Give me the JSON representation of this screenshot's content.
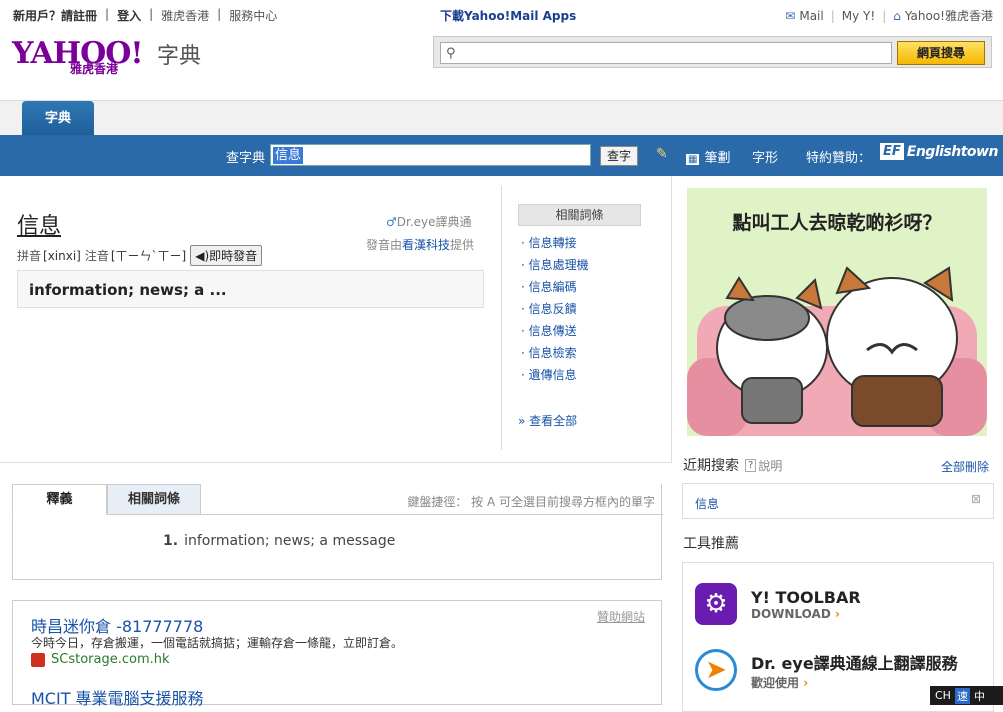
{
  "topbar": {
    "new_user": "新用戶？請註冊",
    "login": "登入",
    "yahoo_hk": "雅虎香港",
    "service": "服務中心",
    "download": "下載Yahoo!Mail Apps",
    "mail": "Mail",
    "my_y": "My Y!",
    "home": "Yahoo!雅虎香港"
  },
  "logo": {
    "brand": "YAHOO!",
    "region": "雅虎香港",
    "product": "字典"
  },
  "websearch": {
    "value": "",
    "button": "網頁搜尋"
  },
  "nav": {
    "tab": "字典"
  },
  "lookup": {
    "label": "查字典",
    "query": "信息",
    "button": "查字",
    "strokes": "筆劃",
    "shape": "字形",
    "sponsor": "特約贊助：",
    "sponsor_ef": "EF",
    "sponsor_name": "Englishtown"
  },
  "entry": {
    "word": "信息",
    "pinyin_label": "拼音",
    "pinyin": "[xinxi]",
    "zhuyin_label": "注音",
    "zhuyin": "[ㄒㄧㄣˋㄒㄧ]",
    "sound_button": "即時發音",
    "provider": "Dr.eye譯典通",
    "voice_prefix": "發音由",
    "voice_company": "看漢科技",
    "voice_suffix": "提供",
    "summary": "information; news; a ..."
  },
  "related": {
    "header": "相關詞條",
    "items": [
      "信息轉接",
      "信息處理機",
      "信息編碼",
      "信息反饋",
      "信息傳送",
      "信息檢索",
      "遺傳信息"
    ],
    "see_all": "» 查看全部"
  },
  "tabs": {
    "definition": "釋義",
    "related": "相關詞條",
    "shortcut_hint": "鍵盤捷徑： 按 A 可全選目前搜尋方框內的單字"
  },
  "definition": {
    "index": "1.",
    "text": "information; news; a message"
  },
  "ads": {
    "sponsored": "贊助網站",
    "ad1_title": "時昌迷你倉 -81777778",
    "ad1_desc": "今時今日，存倉搬運，一個電話就搞掂；運輸存倉一條龍，立即訂倉。",
    "ad1_url": "SCstorage.com.hk",
    "ad2_title": "MCIT 專業電腦支援服務"
  },
  "banner": {
    "text": "點叫工人去晾乾啲衫呀？"
  },
  "recent": {
    "title": "近期搜索",
    "help": "?",
    "help_label": "說明",
    "clear": "全部刪除",
    "items": [
      "信息"
    ]
  },
  "tools": {
    "title": "工具推薦",
    "toolbar_name": "Y! TOOLBAR",
    "toolbar_sub": "DOWNLOAD",
    "drye_name": "Dr. eye譯典通線上翻譯服務",
    "drye_sub": "歡迎使用"
  },
  "ime": {
    "lang": "CH",
    "mode": "速",
    "script": "中"
  },
  "colors": {
    "blue_bar": "#2a6aa8",
    "yahoo_purple": "#7b0099",
    "link": "#1a53a8",
    "search_button": "#f5b800"
  }
}
